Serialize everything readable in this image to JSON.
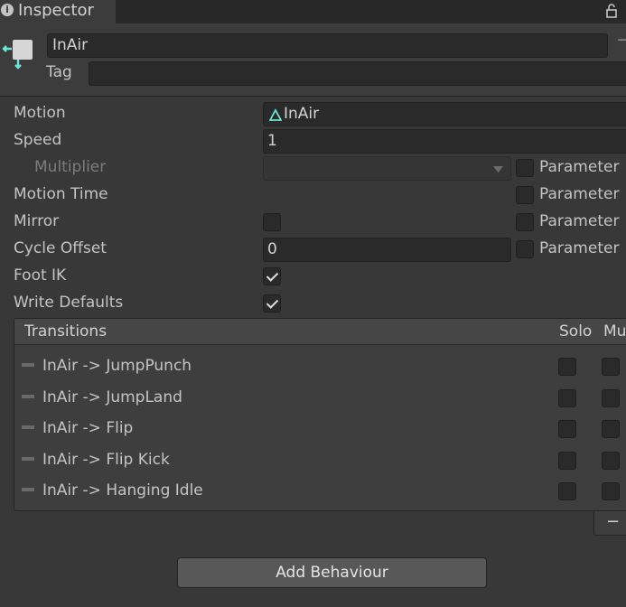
{
  "tab": {
    "title": "Inspector"
  },
  "state": {
    "name": "InAir",
    "tag_label": "Tag",
    "tag_value": ""
  },
  "props": {
    "motion_label": "Motion",
    "motion_value": "InAir",
    "speed_label": "Speed",
    "speed_value": "1",
    "multiplier_label": "Multiplier",
    "motion_time_label": "Motion Time",
    "mirror_label": "Mirror",
    "cycle_offset_label": "Cycle Offset",
    "cycle_offset_value": "0",
    "foot_ik_label": "Foot IK",
    "foot_ik_checked": true,
    "write_defaults_label": "Write Defaults",
    "write_defaults_checked": true,
    "parameter_label": "Parameter"
  },
  "transitions": {
    "header": "Transitions",
    "solo_label": "Solo",
    "mute_label": "Mu",
    "items": [
      {
        "label": "InAir -> JumpPunch"
      },
      {
        "label": "InAir -> JumpLand"
      },
      {
        "label": "InAir -> Flip"
      },
      {
        "label": "InAir -> Flip Kick"
      },
      {
        "label": "InAir -> Hanging Idle"
      }
    ],
    "remove_label": "−"
  },
  "footer": {
    "add_behaviour_label": "Add Behaviour"
  },
  "icons": {
    "info": "info-icon",
    "lock": "lock-icon",
    "state": "animator-state-icon",
    "motion": "animation-clip-icon",
    "dropdown": "dropdown-arrow-icon",
    "menu": "context-menu-icon"
  },
  "colors": {
    "accent": "#6fe3d6",
    "background": "#383838",
    "field": "#2a2a2a"
  }
}
